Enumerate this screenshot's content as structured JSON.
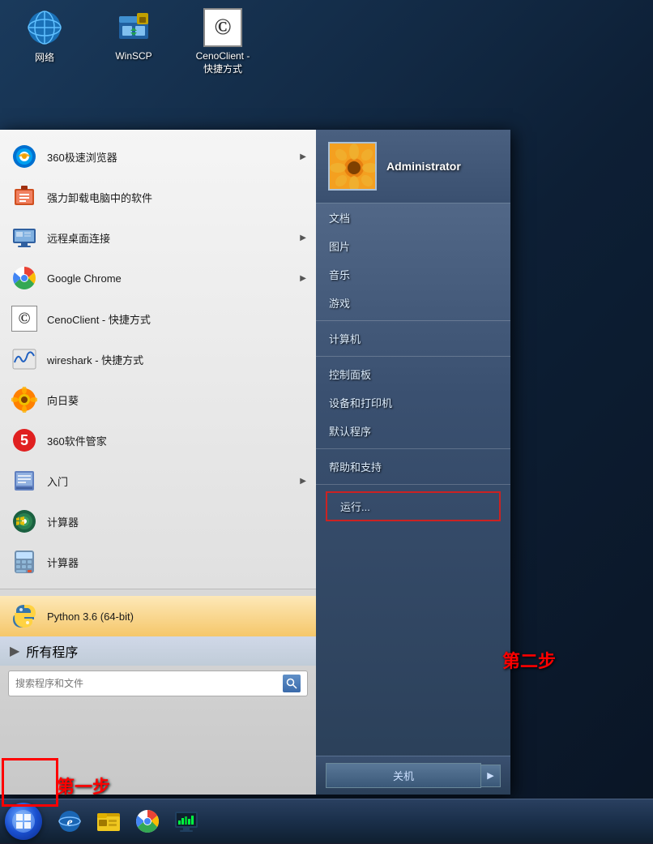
{
  "desktop": {
    "icons": [
      {
        "id": "network",
        "label": "网络",
        "type": "network"
      },
      {
        "id": "winscp",
        "label": "WinSCP",
        "type": "winscp"
      },
      {
        "id": "cenoclient",
        "label": "CenoClient -\n快捷方式",
        "type": "cenoclient"
      }
    ]
  },
  "startMenu": {
    "leftTop": [
      {
        "id": "browser360",
        "label": "360极速浏览器",
        "hasArrow": true,
        "type": "360browser"
      },
      {
        "id": "uninstall",
        "label": "强力卸载电脑中的软件",
        "hasArrow": false,
        "type": "uninstall"
      },
      {
        "id": "remote",
        "label": "远程桌面连接",
        "hasArrow": true,
        "type": "remote"
      },
      {
        "id": "chrome",
        "label": "Google Chrome",
        "hasArrow": true,
        "type": "chrome"
      },
      {
        "id": "cenoclient",
        "label": "CenoClient - 快捷方式",
        "hasArrow": false,
        "type": "cenoclient"
      },
      {
        "id": "wireshark",
        "label": "wireshark - 快捷方式",
        "hasArrow": false,
        "type": "wireshark"
      },
      {
        "id": "sunflower",
        "label": "向日葵",
        "hasArrow": false,
        "type": "sunflower"
      },
      {
        "id": "360mgr",
        "label": "360软件管家",
        "hasArrow": false,
        "type": "360mgr"
      },
      {
        "id": "intro",
        "label": "入门",
        "hasArrow": true,
        "type": "intro"
      },
      {
        "id": "mediacenter",
        "label": "Windows Media Center",
        "hasArrow": false,
        "type": "mediacenter"
      },
      {
        "id": "calculator",
        "label": "计算器",
        "hasArrow": false,
        "type": "calculator"
      }
    ],
    "leftBottom": [
      {
        "id": "python",
        "label": "Python 3.6 (64-bit)",
        "hasArrow": false,
        "type": "python",
        "active": true
      }
    ],
    "allPrograms": "所有程序",
    "searchPlaceholder": "搜索程序和文件",
    "right": {
      "username": "Administrator",
      "items": [
        {
          "id": "documents",
          "label": "文档"
        },
        {
          "id": "pictures",
          "label": "图片"
        },
        {
          "id": "music",
          "label": "音乐"
        },
        {
          "id": "games",
          "label": "游戏"
        },
        {
          "id": "computer",
          "label": "计算机"
        },
        {
          "id": "controlpanel",
          "label": "控制面板"
        },
        {
          "id": "devices",
          "label": "设备和打印机"
        },
        {
          "id": "defaultprograms",
          "label": "默认程序"
        },
        {
          "id": "help",
          "label": "帮助和支持"
        }
      ],
      "run": "运行...",
      "shutdown": "关机"
    }
  },
  "stepLabels": {
    "step1": "第一步",
    "step2": "第二步"
  },
  "taskbar": {
    "items": [
      {
        "id": "ie",
        "type": "ie"
      },
      {
        "id": "explorer",
        "type": "explorer"
      },
      {
        "id": "chrome",
        "type": "chrome"
      },
      {
        "id": "monitor",
        "type": "monitor"
      }
    ]
  }
}
